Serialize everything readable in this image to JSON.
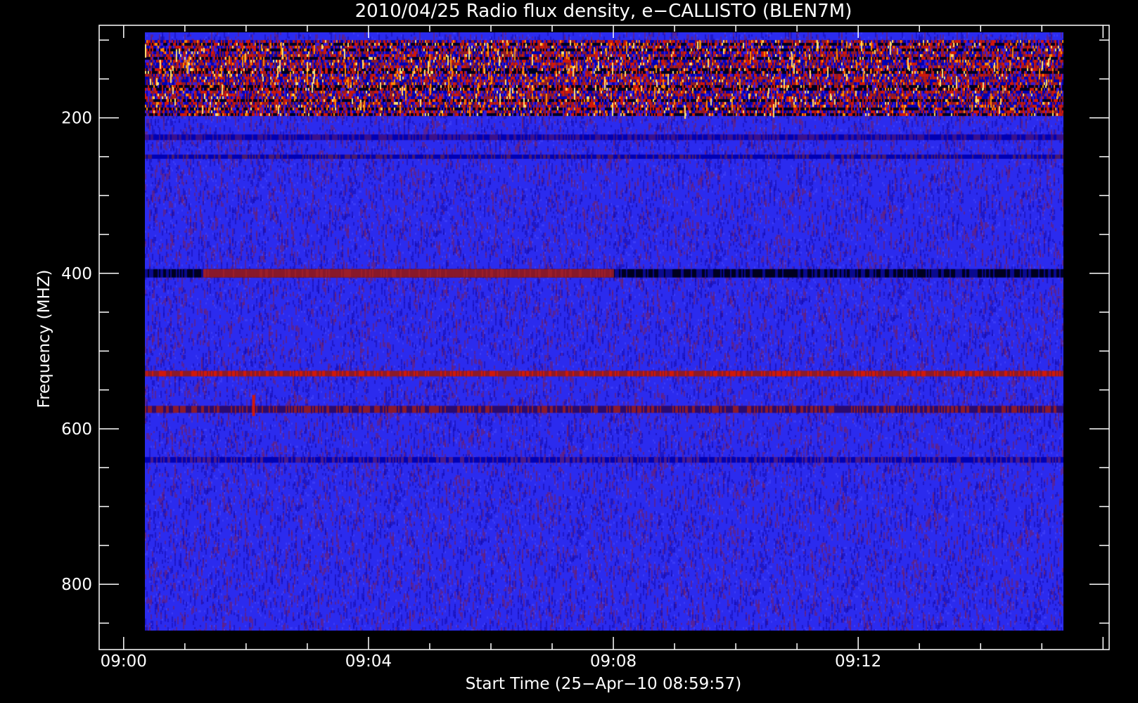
{
  "chart_data": {
    "type": "heatmap",
    "title": "2010/04/25  Radio flux density, e−CALLISTO (BLEN7M)",
    "xlabel": "Start Time (25−Apr−10 08:59:57)",
    "ylabel": "Frequency (MHZ)",
    "x_tick_labels": [
      "09:00",
      "09:04",
      "09:08",
      "09:12"
    ],
    "x_tick_values_min": [
      0,
      4,
      8,
      12
    ],
    "x_range_min": [
      -0.4,
      16.1
    ],
    "x_data_range_min": [
      0.35,
      15.35
    ],
    "y_tick_labels": [
      "200",
      "400",
      "600",
      "800"
    ],
    "y_tick_values": [
      200,
      400,
      600,
      800
    ],
    "y_range": [
      81,
      884
    ],
    "y_data_range": [
      90,
      860
    ],
    "y_inverted": true,
    "colormap": [
      "#000020",
      "#0000b4",
      "#3a1bdc",
      "#8c1a2a",
      "#d0180a",
      "#ff8c00",
      "#ffe070"
    ],
    "background_color": "#2b2bee",
    "features": [
      {
        "freq_range": [
          100,
          195
        ],
        "intensity": "high"
      },
      {
        "freq": 400,
        "time_range_min": [
          1.3,
          8.0
        ],
        "intensity": "enhanced"
      },
      {
        "freq": 529,
        "intensity": "enhanced"
      },
      {
        "freq": 570,
        "time_min": 2.1,
        "intensity": "spike"
      },
      {
        "freq": 640,
        "intensity": "weak"
      }
    ]
  }
}
